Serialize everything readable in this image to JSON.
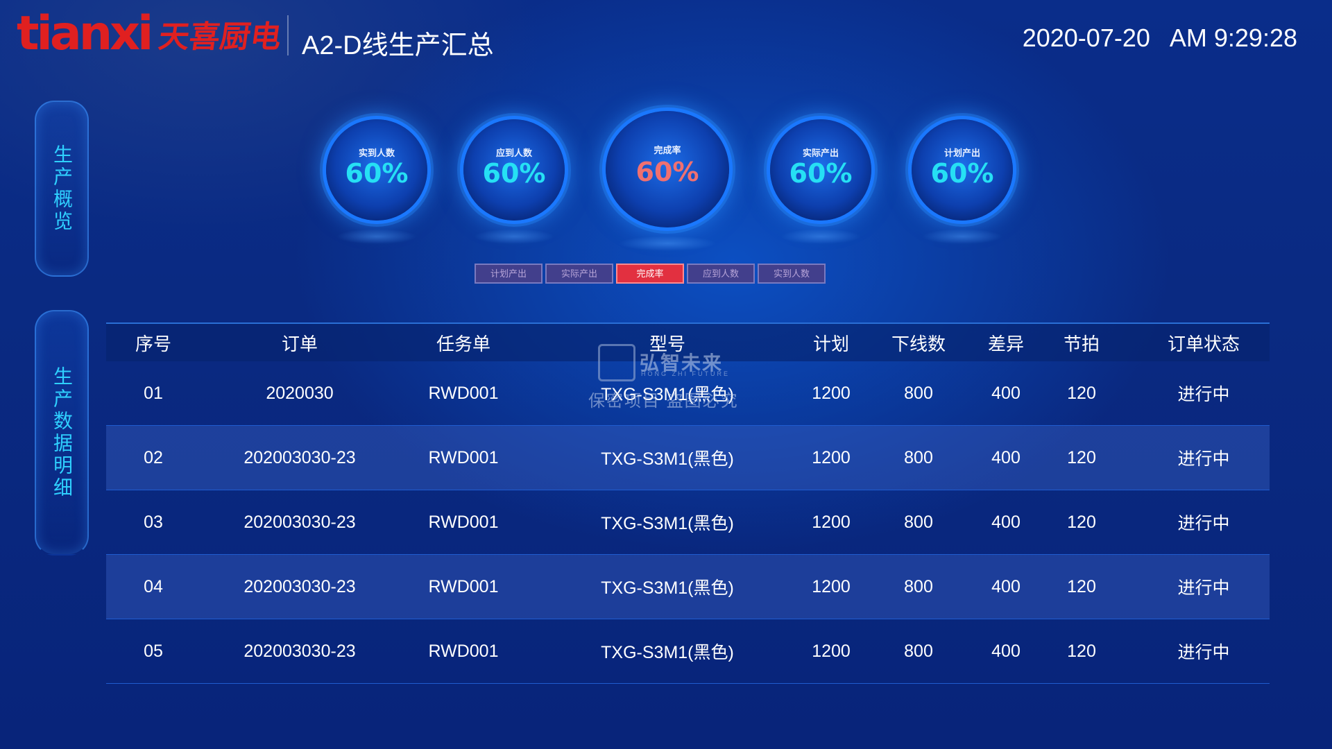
{
  "header": {
    "logo_en": "tianxi",
    "logo_cn": "天喜厨电",
    "title": "A2-D线生产汇总",
    "date": "2020-07-20",
    "time": "AM 9:29:28"
  },
  "sidebar": {
    "tabs": [
      {
        "label": "生产概览"
      },
      {
        "label": "生产数据明细"
      }
    ]
  },
  "gauges": [
    {
      "label": "实到人数",
      "value": "60%"
    },
    {
      "label": "应到人数",
      "value": "60%"
    },
    {
      "label": "完成率",
      "value": "60%"
    },
    {
      "label": "实际产出",
      "value": "60%"
    },
    {
      "label": "计划产出",
      "value": "60%"
    }
  ],
  "buttons": [
    {
      "label": "计划产出"
    },
    {
      "label": "实际产出"
    },
    {
      "label": "完成率"
    },
    {
      "label": "应到人数"
    },
    {
      "label": "实到人数"
    }
  ],
  "active_button": "完成率",
  "table": {
    "headers": [
      "序号",
      "订单",
      "任务单",
      "型号",
      "计划",
      "下线数",
      "差异",
      "节拍",
      "订单状态"
    ],
    "rows": [
      [
        "01",
        "2020030",
        "RWD001",
        "TXG-S3M1(黑色)",
        "1200",
        "800",
        "400",
        "120",
        "进行中"
      ],
      [
        "02",
        "202003030-23",
        "RWD001",
        "TXG-S3M1(黑色)",
        "1200",
        "800",
        "400",
        "120",
        "进行中"
      ],
      [
        "03",
        "202003030-23",
        "RWD001",
        "TXG-S3M1(黑色)",
        "1200",
        "800",
        "400",
        "120",
        "进行中"
      ],
      [
        "04",
        "202003030-23",
        "RWD001",
        "TXG-S3M1(黑色)",
        "1200",
        "800",
        "400",
        "120",
        "进行中"
      ],
      [
        "05",
        "202003030-23",
        "RWD001",
        "TXG-S3M1(黑色)",
        "1200",
        "800",
        "400",
        "120",
        "进行中"
      ]
    ]
  },
  "watermark": {
    "cn": "弘智未来",
    "en": "HONG ZHI FUTURE",
    "sub": "保密项目 盗图必究"
  },
  "colors": {
    "accent_cyan": "#26e0f4",
    "alert_red": "#e23040",
    "brand_red": "#e02020",
    "background": "#0a2d8a"
  }
}
